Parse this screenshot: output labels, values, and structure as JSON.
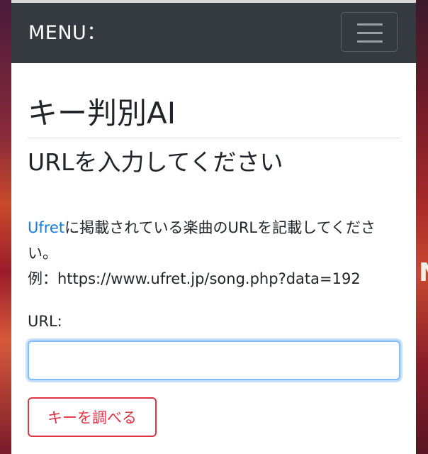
{
  "navbar": {
    "brand": "MENU：",
    "toggler_icon": "hamburger-icon"
  },
  "main": {
    "title": "キー判別AI",
    "subtitle": "URLを入力してください",
    "description": {
      "link_text": "Ufret",
      "text_line": "に掲載されている楽曲のURLを記載してください。",
      "example": "例：https://www.ufret.jp/song.php?data=192"
    },
    "form": {
      "url_label": "URL:",
      "url_value": "",
      "submit_label": "キーを調べる"
    }
  },
  "background": {
    "edge_glyph": "N"
  },
  "colors": {
    "navbar_bg": "#343a40",
    "link": "#1a7ad8",
    "danger": "#dc3545",
    "focus": "#80bdff"
  }
}
